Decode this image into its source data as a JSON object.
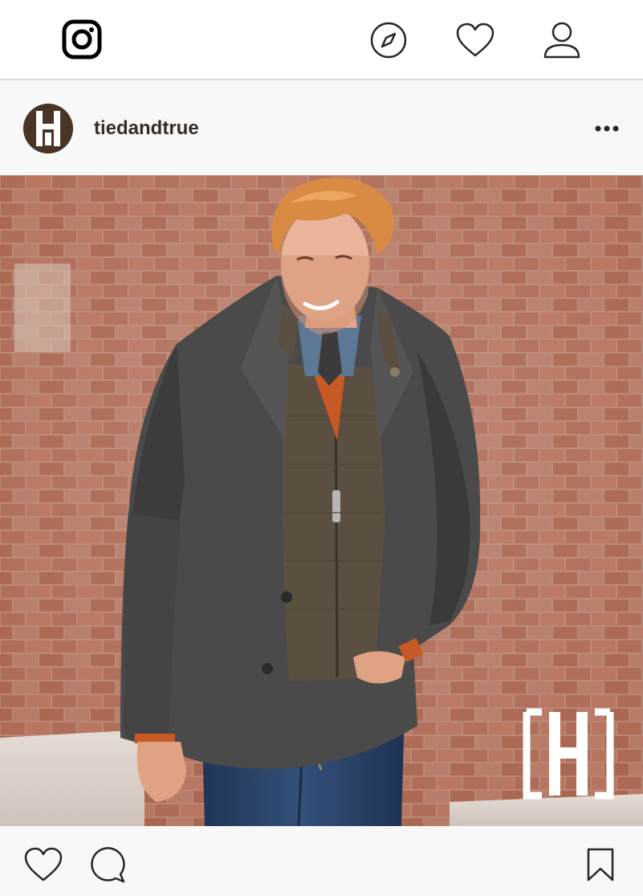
{
  "nav": {
    "logo_icon": "instagram-logo-icon",
    "explore_icon": "compass-icon",
    "activity_icon": "heart-icon",
    "profile_icon": "user-icon"
  },
  "post": {
    "username": "tiedandtrue",
    "avatar_icon": "tiedandtrue-logo",
    "more_icon": "more-options-icon",
    "watermark_icon": "tiedandtrue-watermark-logo"
  },
  "actions": {
    "like_icon": "heart-icon",
    "comment_icon": "speech-bubble-icon",
    "save_icon": "bookmark-icon"
  },
  "colors": {
    "nav_background": "#ffffff",
    "header_background": "#f8f8f8",
    "divider": "#dbdbdb",
    "username_text": "#3a2c22",
    "avatar_brown": "#4a3426"
  }
}
